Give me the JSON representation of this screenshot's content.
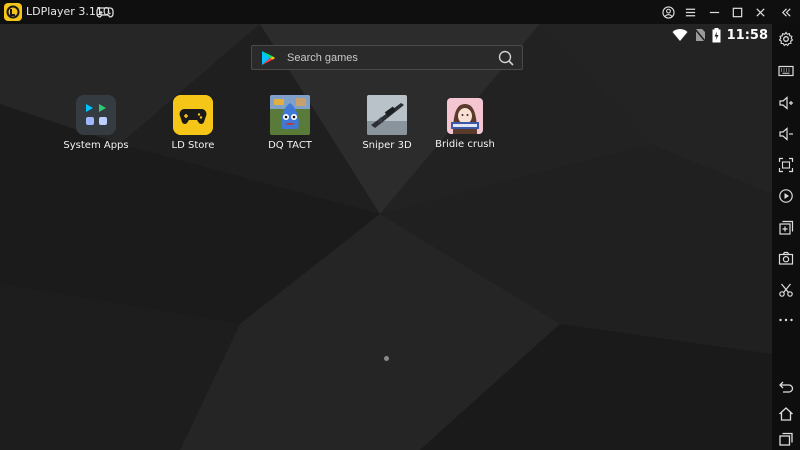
{
  "window": {
    "title": "LDPlayer 3.110"
  },
  "status": {
    "time": "11:58"
  },
  "search": {
    "placeholder": "Search games"
  },
  "apps": [
    {
      "label": "System Apps"
    },
    {
      "label": "LD Store"
    },
    {
      "label": "DQ TACT"
    },
    {
      "label": "Sniper 3D"
    },
    {
      "label": "Bridie crush"
    }
  ],
  "sidebar": {
    "items": [
      {
        "icon": "settings-icon"
      },
      {
        "icon": "keyboard-icon"
      },
      {
        "icon": "volume-up-icon"
      },
      {
        "icon": "volume-down-icon"
      },
      {
        "icon": "fullscreen-icon"
      },
      {
        "icon": "record-icon"
      },
      {
        "icon": "add-apk-icon"
      },
      {
        "icon": "screenshot-icon"
      },
      {
        "icon": "scissors-icon"
      },
      {
        "icon": "more-icon"
      },
      {
        "icon": "back-icon"
      },
      {
        "icon": "home-icon"
      },
      {
        "icon": "recents-icon"
      }
    ]
  },
  "colors": {
    "brand": "#f5c518",
    "background": "#1e1e1e",
    "titlebar": "#0f0f0f"
  }
}
